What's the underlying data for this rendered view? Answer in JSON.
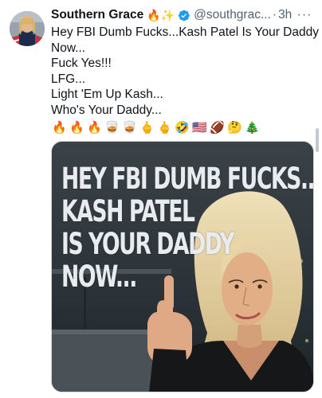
{
  "tweet": {
    "author_name": "Southern Grace",
    "name_emoji": "🔥✨",
    "handle": "@southgrac...",
    "separator": "·",
    "time": "3h",
    "more_glyph": "···",
    "verified_color": "#1d9bf0",
    "text_lines": [
      "Hey FBI Dumb Fucks...Kash Patel Is Your Daddy",
      "Now...",
      "Fuck Yes!!!",
      "LFG...",
      "Light 'Em Up Kash...",
      "Who's Your Daddy..."
    ],
    "emojis": [
      "🔥",
      "🔥",
      "🔥",
      "🥃",
      "🥃",
      "🖕",
      "🖕",
      "🤣",
      "🇺🇸",
      "🏈",
      "🤔",
      "🎄"
    ],
    "image": {
      "overlay_lines": [
        "HEY FBI DUMB FUCKS...",
        "KASH PATEL",
        "IS YOUR DADDY",
        "NOW..."
      ]
    }
  }
}
